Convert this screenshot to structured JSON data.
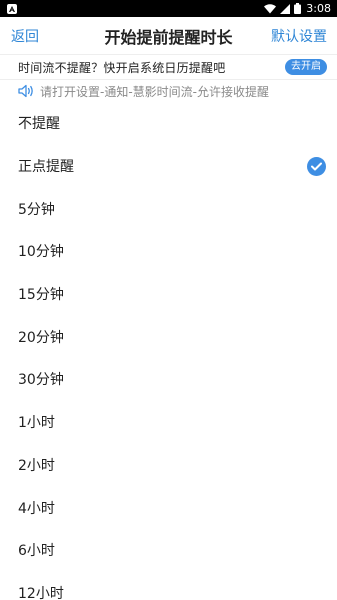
{
  "status_bar": {
    "time": "3:08"
  },
  "header": {
    "back_label": "返回",
    "title": "开始提前提醒时长",
    "reset_label": "默认设置"
  },
  "notice": {
    "text": "时间流不提醒？快开启系统日历提醒吧",
    "button_label": "去开启"
  },
  "hint": {
    "icon": "speaker-icon",
    "text": "请打开设置-通知-慧影时间流-允许接收提醒"
  },
  "options": [
    {
      "label": "不提醒",
      "selected": false
    },
    {
      "label": "正点提醒",
      "selected": true
    },
    {
      "label": "5分钟",
      "selected": false
    },
    {
      "label": "10分钟",
      "selected": false
    },
    {
      "label": "15分钟",
      "selected": false
    },
    {
      "label": "20分钟",
      "selected": false
    },
    {
      "label": "30分钟",
      "selected": false
    },
    {
      "label": "1小时",
      "selected": false
    },
    {
      "label": "2小时",
      "selected": false
    },
    {
      "label": "4小时",
      "selected": false
    },
    {
      "label": "6小时",
      "selected": false
    },
    {
      "label": "12小时",
      "selected": false
    }
  ],
  "colors": {
    "accent": "#3e8ee3",
    "link": "#2f86d6",
    "hint_text": "#8a8a8a"
  }
}
